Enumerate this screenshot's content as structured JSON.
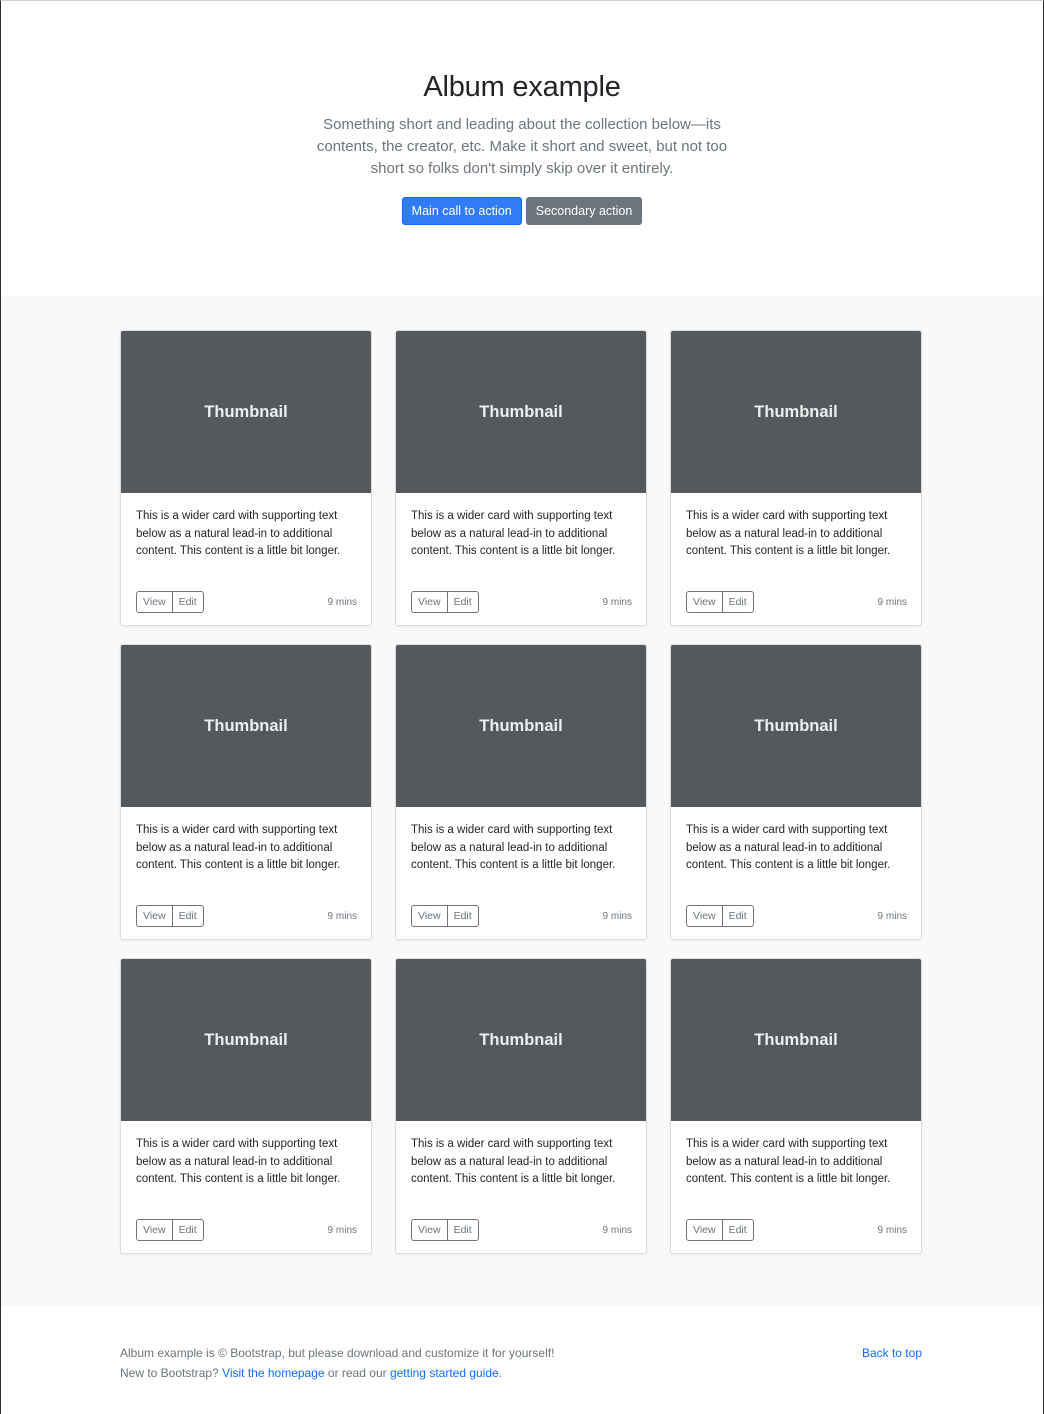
{
  "hero": {
    "title": "Album example",
    "lead": "Something short and leading about the collection below—its contents, the creator, etc. Make it short and sweet, but not too short so folks don't simply skip over it entirely.",
    "primary_button": "Main call to action",
    "secondary_button": "Secondary action"
  },
  "colors": {
    "primary": "#2f7cf6",
    "secondary": "#6c757d",
    "thumbnail_bg": "#55595c",
    "album_bg": "#f8f9fa",
    "link": "#0d6efd"
  },
  "cards": [
    {
      "thumb_label": "Thumbnail",
      "text": "This is a wider card with supporting text below as a natural lead-in to additional content. This content is a little bit longer.",
      "view_label": "View",
      "edit_label": "Edit",
      "time": "9 mins"
    },
    {
      "thumb_label": "Thumbnail",
      "text": "This is a wider card with supporting text below as a natural lead-in to additional content. This content is a little bit longer.",
      "view_label": "View",
      "edit_label": "Edit",
      "time": "9 mins"
    },
    {
      "thumb_label": "Thumbnail",
      "text": "This is a wider card with supporting text below as a natural lead-in to additional content. This content is a little bit longer.",
      "view_label": "View",
      "edit_label": "Edit",
      "time": "9 mins"
    },
    {
      "thumb_label": "Thumbnail",
      "text": "This is a wider card with supporting text below as a natural lead-in to additional content. This content is a little bit longer.",
      "view_label": "View",
      "edit_label": "Edit",
      "time": "9 mins"
    },
    {
      "thumb_label": "Thumbnail",
      "text": "This is a wider card with supporting text below as a natural lead-in to additional content. This content is a little bit longer.",
      "view_label": "View",
      "edit_label": "Edit",
      "time": "9 mins"
    },
    {
      "thumb_label": "Thumbnail",
      "text": "This is a wider card with supporting text below as a natural lead-in to additional content. This content is a little bit longer.",
      "view_label": "View",
      "edit_label": "Edit",
      "time": "9 mins"
    },
    {
      "thumb_label": "Thumbnail",
      "text": "This is a wider card with supporting text below as a natural lead-in to additional content. This content is a little bit longer.",
      "view_label": "View",
      "edit_label": "Edit",
      "time": "9 mins"
    },
    {
      "thumb_label": "Thumbnail",
      "text": "This is a wider card with supporting text below as a natural lead-in to additional content. This content is a little bit longer.",
      "view_label": "View",
      "edit_label": "Edit",
      "time": "9 mins"
    },
    {
      "thumb_label": "Thumbnail",
      "text": "This is a wider card with supporting text below as a natural lead-in to additional content. This content is a little bit longer.",
      "view_label": "View",
      "edit_label": "Edit",
      "time": "9 mins"
    }
  ],
  "footer": {
    "line1": "Album example is © Bootstrap, but please download and customize it for yourself!",
    "line2_prefix": "New to Bootstrap? ",
    "homepage_link": "Visit the homepage",
    "line2_middle": " or read our ",
    "guide_link": "getting started guide",
    "line2_suffix": ".",
    "back_to_top": "Back to top"
  }
}
